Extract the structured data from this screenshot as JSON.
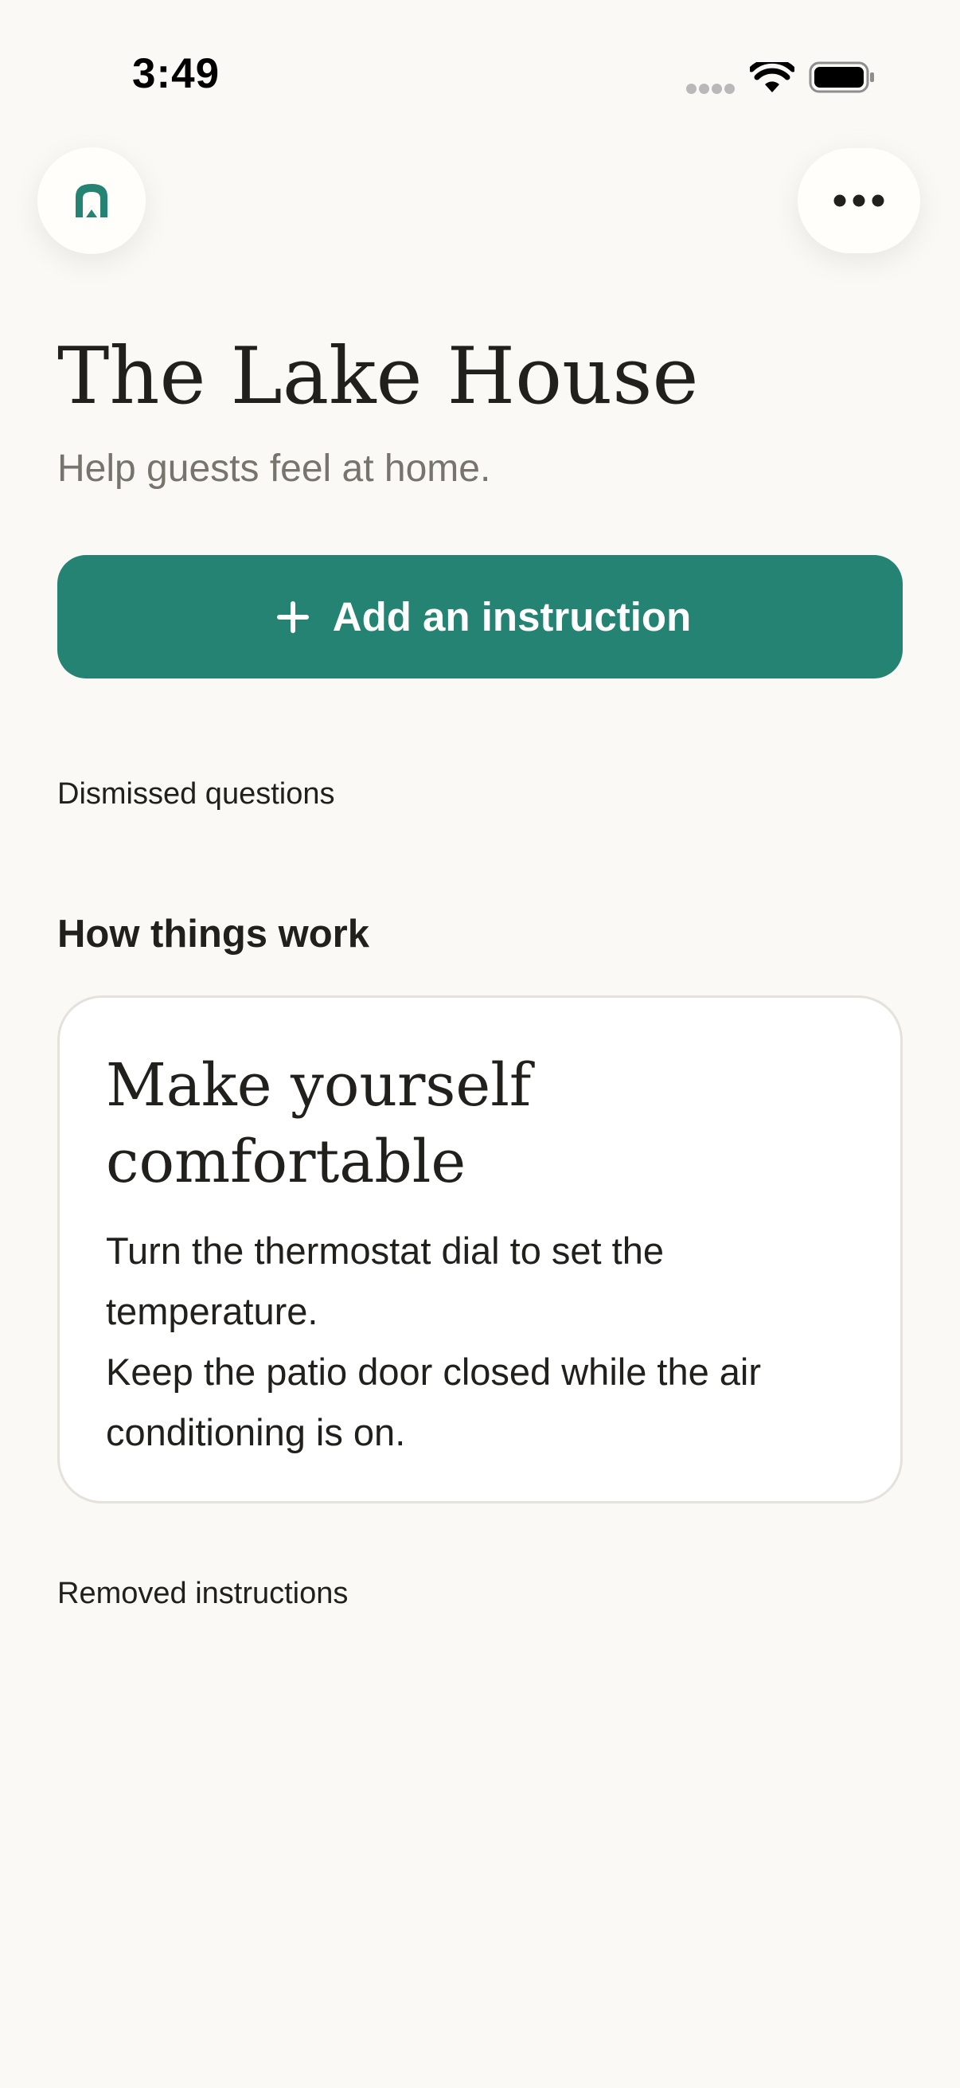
{
  "status_bar": {
    "time": "3:49"
  },
  "header": {
    "home_icon": "house-arch-icon",
    "more_icon": "more-horizontal-icon"
  },
  "page": {
    "title": "The Lake House",
    "subtitle": "Help guests feel at home."
  },
  "actions": {
    "add_instruction_label": "Add an instruction",
    "add_icon": "plus-icon",
    "dismissed_questions_label": "Dismissed questions",
    "removed_instructions_label": "Removed instructions"
  },
  "section": {
    "heading": "How things work"
  },
  "card": {
    "title": "Make yourself comfortable",
    "lines": [
      "Turn the thermostat dial to set the temperature.",
      "Keep the patio door closed while the air conditioning is on."
    ]
  },
  "colors": {
    "accent": "#248373",
    "background": "#faf9f6",
    "text": "#22201c",
    "muted_text": "#77736d"
  }
}
